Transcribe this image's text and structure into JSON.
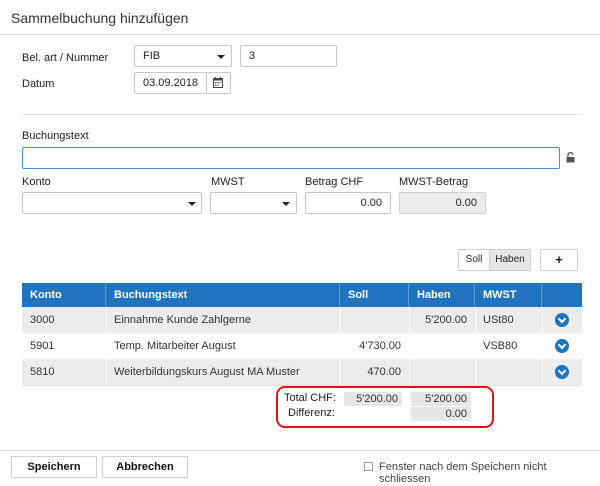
{
  "dialog": {
    "title": "Sammelbuchung hinzufügen"
  },
  "form": {
    "belart_label": "Bel. art / Nummer",
    "belart_value": "FIB",
    "nummer_value": "3",
    "datum_label": "Datum",
    "datum_value": "03.09.2018",
    "buchungstext_label": "Buchungstext",
    "buchungstext_value": "",
    "konto_label": "Konto",
    "mwst_label": "MWST",
    "betrag_label": "Betrag CHF",
    "betrag_value": "0.00",
    "mwst_betrag_label": "MWST-Betrag",
    "mwst_betrag_value": "0.00"
  },
  "toggle": {
    "soll_label": "Soll",
    "haben_label": "Haben",
    "add_label": "+"
  },
  "table": {
    "headers": [
      "Konto",
      "Buchungstext",
      "Soll",
      "Haben",
      "MWST"
    ],
    "rows": [
      {
        "konto": "3000",
        "text": "Einnahme Kunde Zahlgerne",
        "soll": "",
        "haben": "5'200.00",
        "mwst": "USt80"
      },
      {
        "konto": "5901",
        "text": "Temp. Mitarbeiter August",
        "soll": "4'730.00",
        "haben": "",
        "mwst": "VSB80"
      },
      {
        "konto": "5810",
        "text": "Weiterbildungskurs August MA Muster",
        "soll": "470.00",
        "haben": "",
        "mwst": ""
      }
    ]
  },
  "totals": {
    "total_label": "Total CHF:",
    "total_soll": "5'200.00",
    "total_haben": "5'200.00",
    "differenz_label": "Differenz:",
    "differenz_value": "0.00"
  },
  "footer": {
    "save_label": "Speichern",
    "cancel_label": "Abbrechen",
    "checkbox_label": "Fenster nach dem Speichern nicht schliessen"
  },
  "colors": {
    "header_blue": "#1f73bf",
    "highlight_red": "#d9141b",
    "focus_blue": "#4a90d9"
  }
}
